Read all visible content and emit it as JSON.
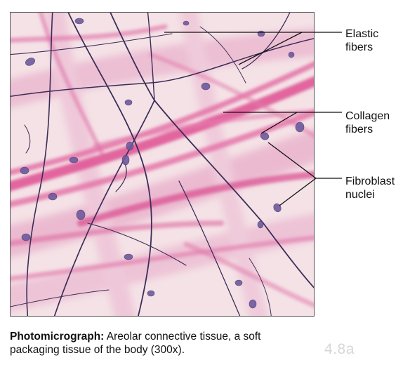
{
  "labels": {
    "elastic": [
      "Elastic",
      "fibers"
    ],
    "collagen": [
      "Collagen",
      "fibers"
    ],
    "fibroblast": [
      "Fibroblast",
      "nuclei"
    ]
  },
  "caption": {
    "bold": "Photomicrograph:",
    "text": " Areolar connective tissue, a soft packaging tissue of the body (300x)."
  },
  "slide_id": "4.8a",
  "colors": {
    "collagen": "#e05a9a",
    "elastic": "#3b2d57",
    "nucleus": "#6d5a9c",
    "background": "#f3dde3"
  }
}
